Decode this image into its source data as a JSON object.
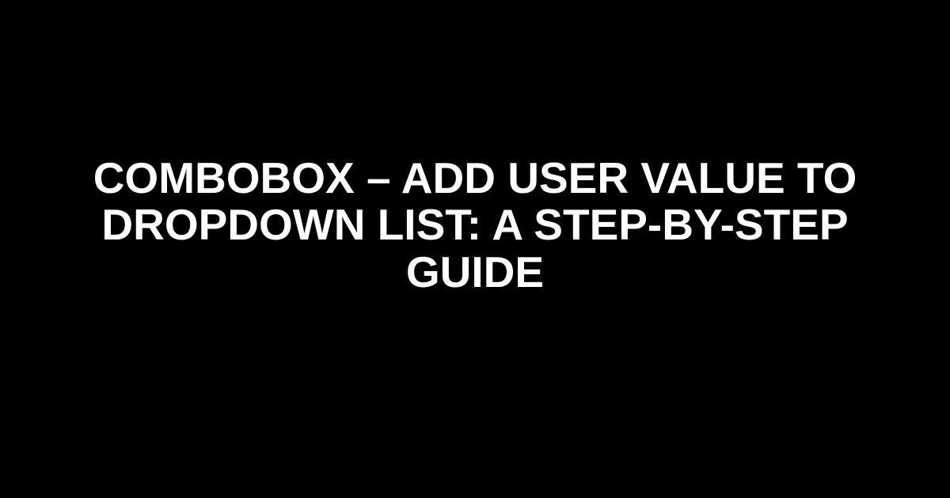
{
  "title": "ComboBox – Add User Value to Dropdown List: A Step-by-Step Guide"
}
